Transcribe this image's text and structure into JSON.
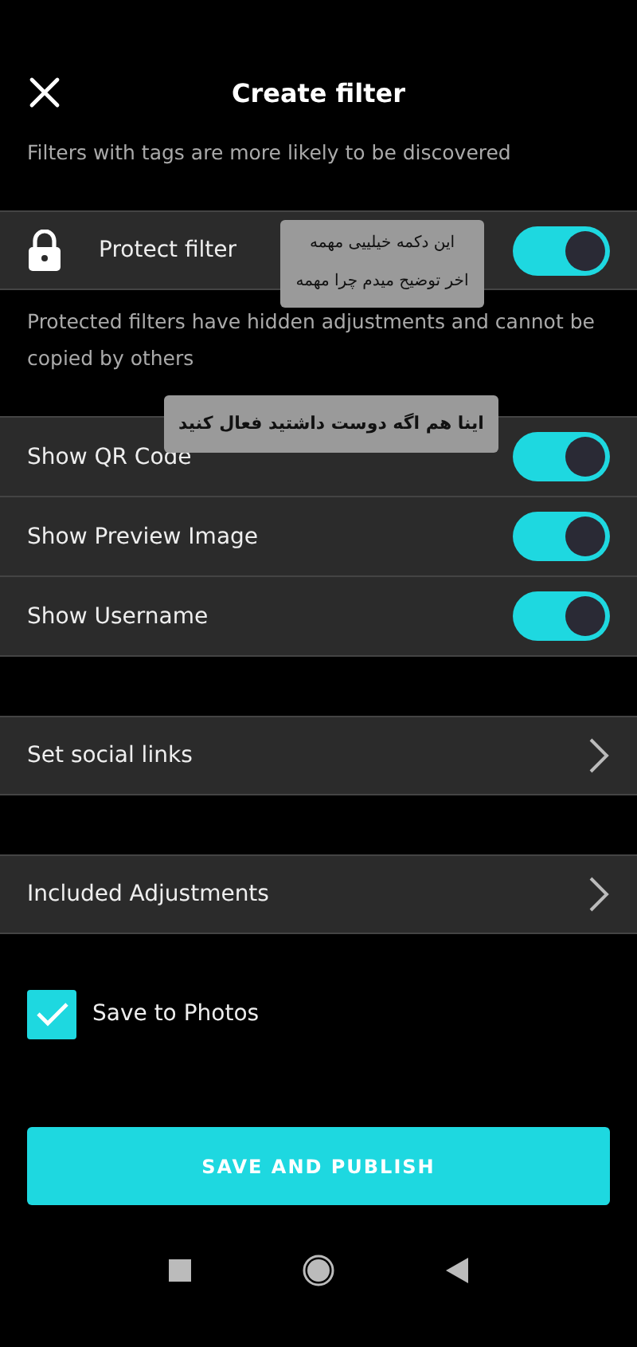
{
  "header": {
    "title": "Create filter"
  },
  "subtitle": "Filters with tags are more likely to be discovered",
  "protect": {
    "label": "Protect filter",
    "on": true,
    "description": "Protected filters have hidden adjustments and cannot be copied by others"
  },
  "toggles": [
    {
      "label": "Show QR Code",
      "on": true
    },
    {
      "label": "Show Preview Image",
      "on": true
    },
    {
      "label": "Show Username",
      "on": true
    }
  ],
  "links": [
    {
      "label": "Set social links"
    },
    {
      "label": "Included Adjustments"
    }
  ],
  "save_to_photos": {
    "label": "Save to Photos",
    "checked": true
  },
  "publish_button": "SAVE AND PUBLISH",
  "annotations": [
    {
      "text": "این دکمه خیلییی مهمه\nاخر توضیح میدم چرا مهمه"
    },
    {
      "text": "اینا هم اگه دوست داشتید فعال کنید"
    }
  ]
}
